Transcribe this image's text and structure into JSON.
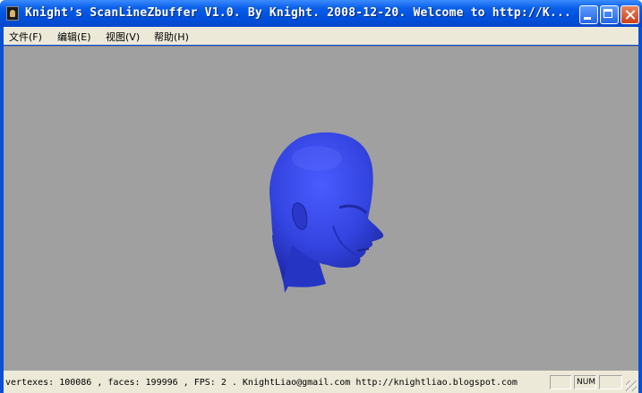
{
  "window": {
    "title": "Knight's ScanLineZbuffer V1.0. By Knight. 2008-12-20.  Welcome to http://K..."
  },
  "menu": {
    "items": [
      {
        "label": "文件(F)"
      },
      {
        "label": "编辑(E)"
      },
      {
        "label": "视图(V)"
      },
      {
        "label": "帮助(H)"
      }
    ]
  },
  "viewport": {
    "background": "#a0a0a0",
    "model": {
      "name": "head-model",
      "color": "#3344e0"
    }
  },
  "status": {
    "info": "vertexes: 100086 , faces: 199996 , FPS: 2 .  KnightLiao@gmail.com  http://knightliao.blogspot.com",
    "indicators": [
      "",
      "NUM",
      ""
    ]
  },
  "colors": {
    "titlebar": "#0052e0",
    "chrome": "#ece9d8",
    "model_blue": "#3344e0"
  }
}
